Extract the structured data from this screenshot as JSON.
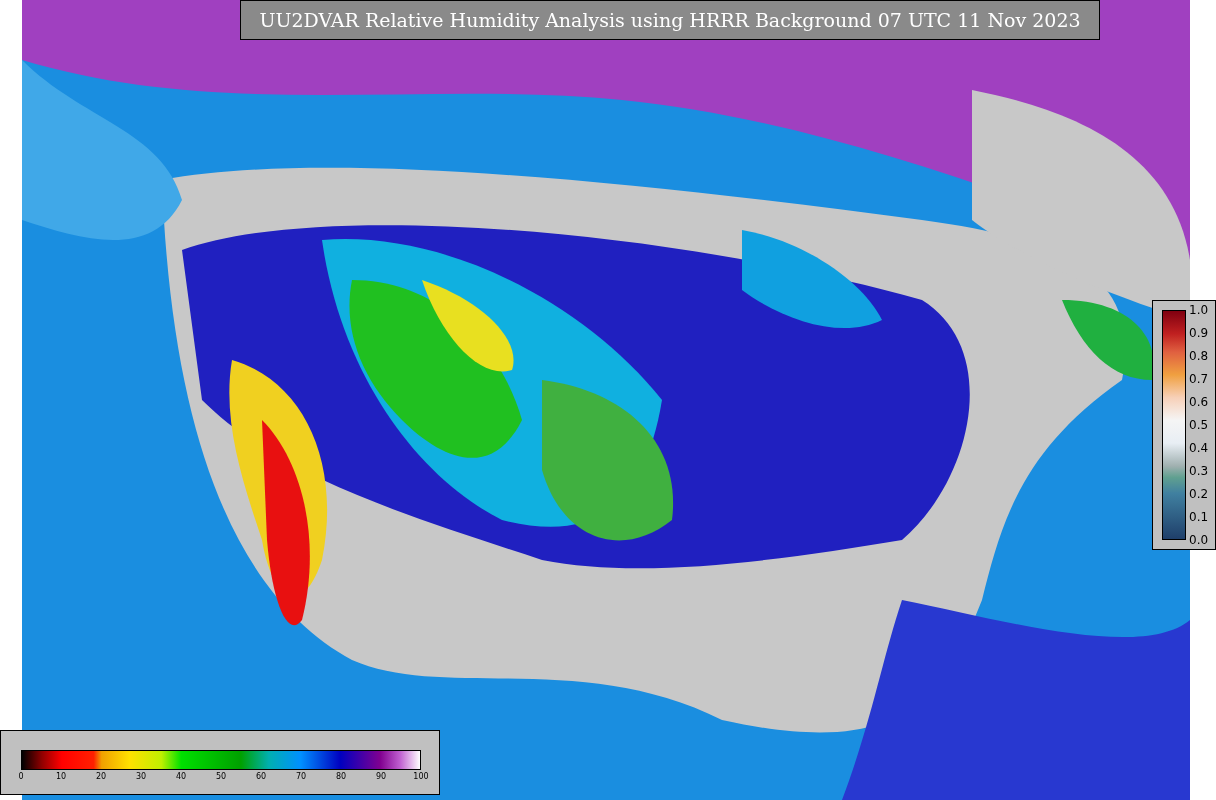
{
  "title": "UU2DVAR Relative Humidity Analysis using HRRR Background 07 UTC 11 Nov 2023",
  "humidity_legend": {
    "ticks": [
      "0",
      "10",
      "20",
      "30",
      "40",
      "50",
      "60",
      "70",
      "80",
      "90",
      "100"
    ]
  },
  "ratio_legend": {
    "ticks": [
      "1.0",
      "0.9",
      "0.8",
      "0.7",
      "0.6",
      "0.5",
      "0.4",
      "0.3",
      "0.2",
      "0.1",
      "0.0"
    ]
  }
}
